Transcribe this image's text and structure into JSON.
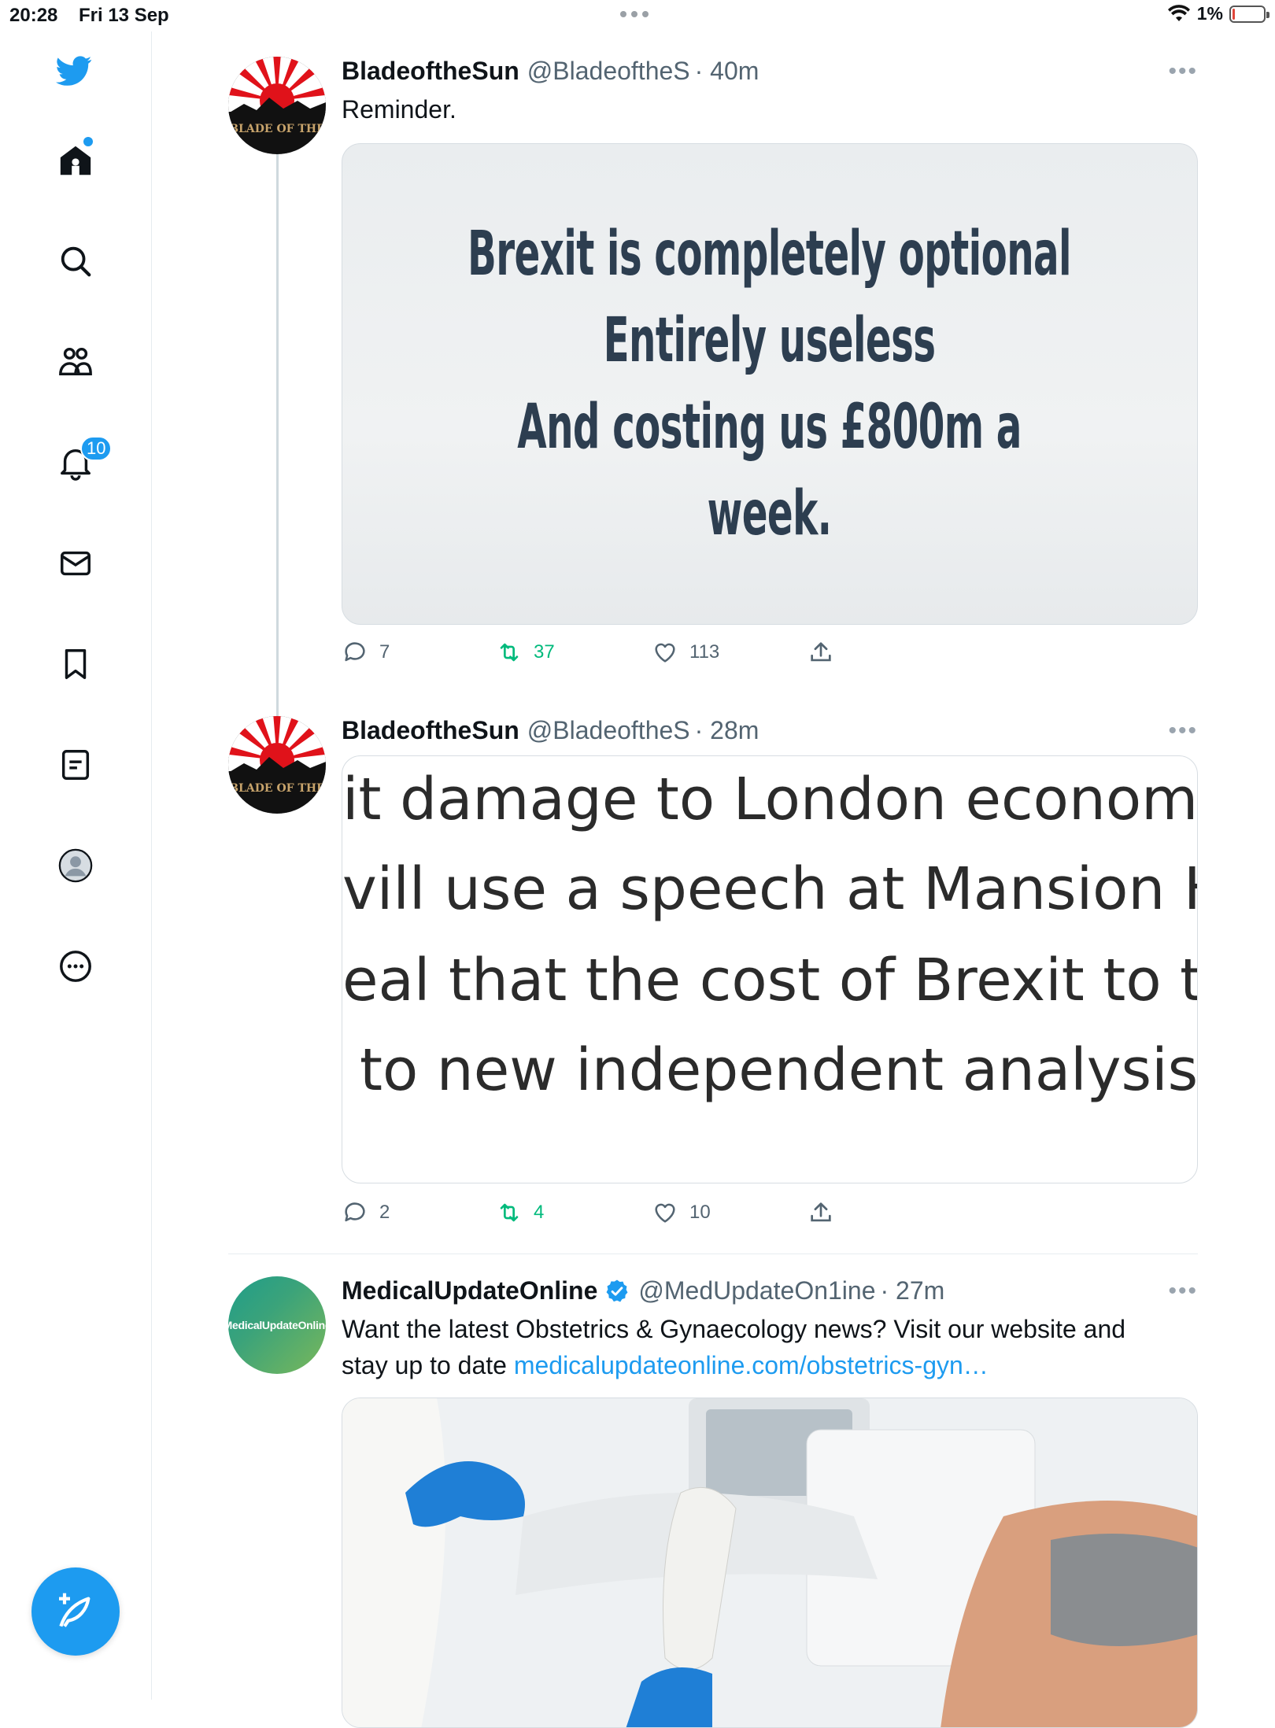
{
  "status_bar": {
    "time": "20:28",
    "date": "Fri 13 Sep",
    "battery": "1%"
  },
  "sidebar": {
    "notifications_badge": "10",
    "items": [
      "home-icon",
      "search-icon",
      "communities-icon",
      "notifications-icon",
      "messages-icon",
      "bookmarks-icon",
      "lists-icon",
      "profile-icon",
      "more-icon"
    ]
  },
  "accent_color": "#1d9bf0",
  "tweets": [
    {
      "name": "BladeoftheSun",
      "handle": "@BladeoftheS",
      "time": "· 40m",
      "text": "Reminder.",
      "avatar_text": "BLADE OF THE",
      "image_lines": [
        "Brexit is completely optional",
        "Entirely useless",
        "And costing us £800m a",
        "week."
      ],
      "replies": "7",
      "retweets": "37",
      "likes": "113"
    },
    {
      "name": "BladeoftheSun",
      "handle": "@BladeoftheS",
      "time": "· 28m",
      "avatar_text": "BLADE OF THE",
      "image_lines": [
        "it damage to London econom",
        "vill use a speech at Mansion H",
        "eal that the cost of Brexit to tl",
        " to new independent analysis."
      ],
      "replies": "2",
      "retweets": "4",
      "likes": "10"
    },
    {
      "name": "MedicalUpdateOnline",
      "handle": "@MedUpdateOn1ine",
      "time": "· 27m",
      "avatar_text": "MedicalUpdateOnline",
      "text_line1": "Want the latest Obstetrics & Gynaecology news? Visit our website and",
      "text_line2": "stay up to date ",
      "link": "medicalupdateonline.com/obstetrics-gyn…"
    }
  ]
}
